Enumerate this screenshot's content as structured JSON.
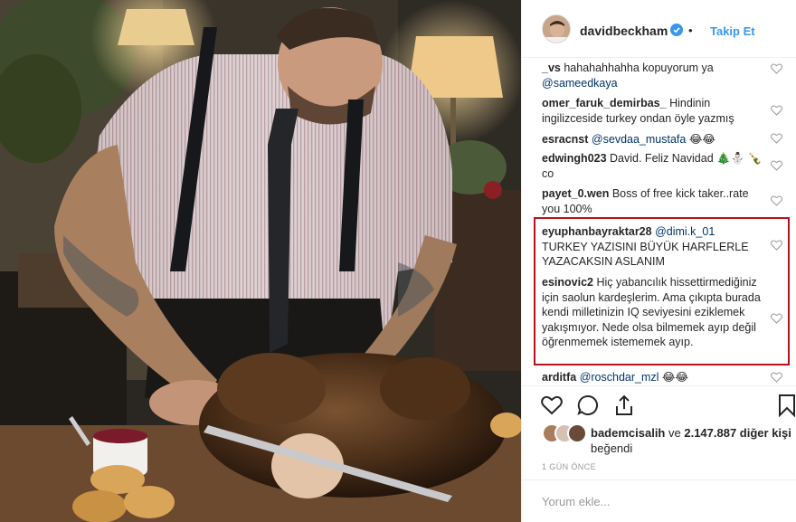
{
  "header": {
    "username": "davidbeckham",
    "separator": "•",
    "follow_label": "Takip Et"
  },
  "comments": [
    {
      "user": "_vs",
      "text": "hahahahhahha kopuyorum ya",
      "mention": "@sameedkaya",
      "tail": ""
    },
    {
      "user": "omer_faruk_demirbas_",
      "text": "Hindinin ingilizceside turkey ondan öyle yazmış",
      "mention": "",
      "tail": ""
    },
    {
      "user": "esracnst",
      "text": "",
      "mention": "@sevdaa_mustafa",
      "tail": "😂😂"
    },
    {
      "user": "edwingh023",
      "text": "David. Feliz Navidad 🎄⛄ 🍾co",
      "mention": "",
      "tail": ""
    },
    {
      "user": "payet_0.wen",
      "text": "Boss of free kick taker..rate you 100%",
      "mention": "",
      "tail": ""
    },
    {
      "user": "eyuphanbayraktar28",
      "text": "TURKEY YAZISINI BÜYÜK HARFLERLE YAZACAKSIN ASLANIM",
      "mention": "@dimi.k_01",
      "tail": ""
    },
    {
      "user": "esinovic2",
      "text": "Hiç yabancılık hissettirmediğiniz için saolun kardeşlerim. Ama çıkıpta burada kendi milletinizin IQ seviyesini eziklemek yakışmıyor. Nede olsa bilmemek ayıp değil öğrenmemek istememek ayıp.",
      "mention": "",
      "tail": ""
    },
    {
      "user": "arditfa",
      "text": "",
      "mention": "@roschdar_mzl",
      "tail": "😂😂"
    }
  ],
  "likes": {
    "user": "bademcisalih",
    "connector": "ve",
    "count": "2.147.887 diğer kişi",
    "suffix": "beğendi"
  },
  "timestamp": "1 GÜN ÖNCE",
  "add_comment_placeholder": "Yorum ekle...",
  "icons": [
    "heart-icon",
    "comment-icon",
    "share-icon",
    "bookmark-icon",
    "verified-badge-icon"
  ],
  "colors": {
    "accent": "#3897f0",
    "highlight": "#b6121b",
    "text": "#262626"
  }
}
